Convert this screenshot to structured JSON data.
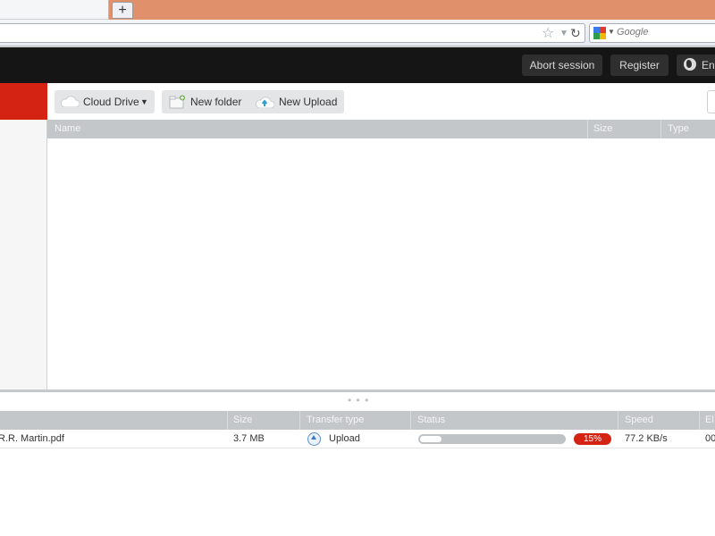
{
  "browser": {
    "new_tab_symbol": "+",
    "search_placeholder": "Google",
    "icons": [
      "star-icon",
      "dropdown-arrow-icon",
      "reload-icon",
      "google-icon"
    ]
  },
  "appbar": {
    "abort_label": "Abort session",
    "register_label": "Register",
    "language_label": "En"
  },
  "toolbar": {
    "cloud_drive_label": "Cloud Drive",
    "new_folder_label": "New folder",
    "new_upload_label": "New Upload"
  },
  "file_list": {
    "columns": [
      "Name",
      "Size",
      "Type"
    ]
  },
  "transfers": {
    "columns": [
      "Size",
      "Transfer type",
      "Status",
      "Speed",
      "El"
    ],
    "rows": [
      {
        "name": "R.R. Martin.pdf",
        "size": "3.7 MB",
        "transfer_type": "Upload",
        "progress_percent": 15,
        "progress_label": "15%",
        "speed": "77.2 KB/s",
        "elapsed": "00"
      }
    ]
  },
  "colors": {
    "brand_red": "#d42213",
    "tab_bar": "#e0916b",
    "app_bar": "#151515",
    "header_gray": "#c3c7c9"
  }
}
